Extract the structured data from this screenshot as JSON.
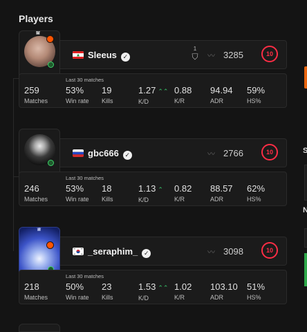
{
  "section_title": "Players",
  "players": [
    {
      "name": "Sleeus",
      "country": "Lebanon",
      "flag_icon": "lebanon-flag-icon",
      "verified": true,
      "party_count": "1",
      "elo": "3285",
      "level": "10",
      "avatar_variant": "crown",
      "last_label": "Last 30 matches",
      "matches": "259",
      "matches_label": "Matches",
      "winrate": "53%",
      "winrate_label": "Win rate",
      "kills": "19",
      "kills_label": "Kills",
      "kd": "1.27",
      "kd_label": "K/D",
      "kd_trend": "up-double",
      "kr": "0.88",
      "kr_label": "K/R",
      "adr": "94.94",
      "adr_label": "ADR",
      "hs": "59%",
      "hs_label": "HS%"
    },
    {
      "name": "gbc666",
      "country": "Russia",
      "flag_icon": "russia-flag-icon",
      "verified": true,
      "elo": "2766",
      "level": "10",
      "last_label": "Last 30 matches",
      "matches": "246",
      "matches_label": "Matches",
      "winrate": "53%",
      "winrate_label": "Win rate",
      "kills": "18",
      "kills_label": "Kills",
      "kd": "1.13",
      "kd_label": "K/D",
      "kd_trend": "up",
      "kr": "0.82",
      "kr_label": "K/R",
      "adr": "88.57",
      "adr_label": "ADR",
      "hs": "62%",
      "hs_label": "HS%"
    },
    {
      "name": "_seraphim_",
      "country": "South Korea",
      "flag_icon": "south-korea-flag-icon",
      "verified": true,
      "elo": "3098",
      "level": "10",
      "last_label": "Last 30 matches",
      "matches": "218",
      "matches_label": "Matches",
      "winrate": "50%",
      "winrate_label": "Win rate",
      "kills": "23",
      "kills_label": "Kills",
      "kd": "1.53",
      "kd_label": "K/D",
      "kd_trend": "up-double",
      "kr": "1.02",
      "kr_label": "K/R",
      "adr": "103.10",
      "adr_label": "ADR",
      "hs": "51%",
      "hs_label": "HS%"
    }
  ],
  "edge_letters": [
    "S",
    "N"
  ],
  "colors": {
    "level_ring": "#ff2d45",
    "positive": "#39c76b",
    "premium_badge": "#ff5500",
    "background": "#141414",
    "card": "#1b1b1b"
  }
}
